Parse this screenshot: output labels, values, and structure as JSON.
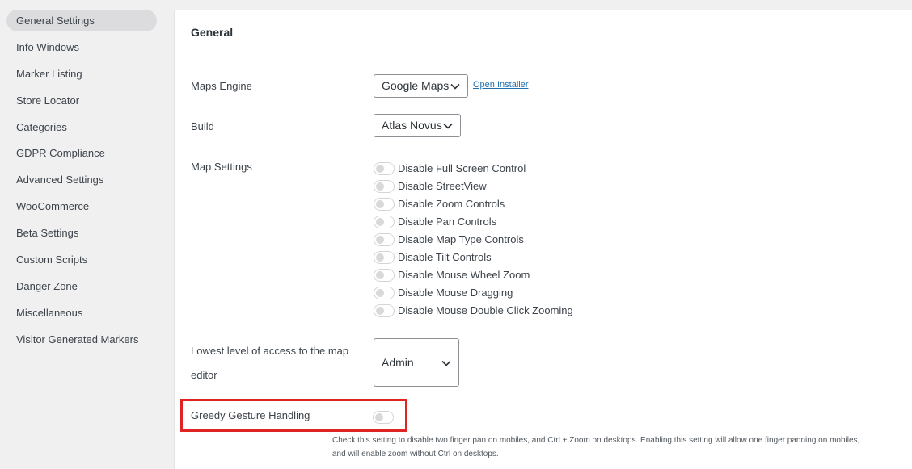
{
  "sidebar": {
    "items": [
      {
        "label": "General Settings",
        "active": true
      },
      {
        "label": "Info Windows"
      },
      {
        "label": "Marker Listing"
      },
      {
        "label": "Store Locator"
      },
      {
        "label": "Categories"
      },
      {
        "label": "GDPR Compliance"
      },
      {
        "label": "Advanced Settings"
      },
      {
        "label": "WooCommerce"
      },
      {
        "label": "Beta Settings"
      },
      {
        "label": "Custom Scripts"
      },
      {
        "label": "Danger Zone"
      },
      {
        "label": "Miscellaneous"
      },
      {
        "label": "Visitor Generated Markers"
      }
    ]
  },
  "panel": {
    "title": "General",
    "maps_engine": {
      "label": "Maps Engine",
      "value": "Google Maps",
      "link": "Open Installer"
    },
    "build": {
      "label": "Build",
      "value": "Atlas Novus"
    },
    "map_settings": {
      "label": "Map Settings",
      "toggles": [
        {
          "label": "Disable Full Screen Control",
          "on": false
        },
        {
          "label": "Disable StreetView",
          "on": false
        },
        {
          "label": "Disable Zoom Controls",
          "on": false
        },
        {
          "label": "Disable Pan Controls",
          "on": false
        },
        {
          "label": "Disable Map Type Controls",
          "on": false
        },
        {
          "label": "Disable Tilt Controls",
          "on": false
        },
        {
          "label": "Disable Mouse Wheel Zoom",
          "on": false
        },
        {
          "label": "Disable Mouse Dragging",
          "on": false
        },
        {
          "label": "Disable Mouse Double Click Zooming",
          "on": false
        }
      ]
    },
    "access": {
      "label_line1": "Lowest level of access to the map",
      "label_line2": "editor",
      "value": "Admin"
    },
    "greedy": {
      "label": "Greedy Gesture Handling",
      "on": false,
      "help_line1": "Check this setting to disable two finger pan on mobiles, and Ctrl + Zoom on desktops. Enabling this setting will allow one finger panning on mobiles,",
      "help_line2": "and will enable zoom without Ctrl on desktops."
    }
  },
  "colors": {
    "highlight": "#e02424",
    "link": "#2271b1",
    "active_nav": "#dcdcde"
  }
}
